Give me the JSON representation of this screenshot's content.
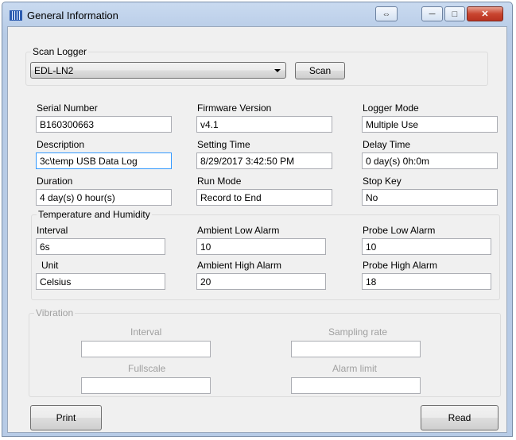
{
  "window": {
    "title": "General Information",
    "icons": {
      "app": "logger-icon",
      "switch": "switch-arrows-icon",
      "minimize": "minimize-icon",
      "maximize": "maximize-icon",
      "close": "close-icon"
    }
  },
  "scan_logger": {
    "legend": "Scan Logger",
    "selected": "EDL-LN2",
    "scan_label": "Scan"
  },
  "info": {
    "serial_number": {
      "label": "Serial Number",
      "value": "B160300663"
    },
    "firmware_version": {
      "label": "Firmware Version",
      "value": "v4.1"
    },
    "logger_mode": {
      "label": "Logger Mode",
      "value": "Multiple Use"
    },
    "description": {
      "label": "Description",
      "value": "3c\\temp USB Data Log"
    },
    "setting_time": {
      "label": "Setting Time",
      "value": "8/29/2017 3:42:50 PM"
    },
    "delay_time": {
      "label": "Delay Time",
      "value": "0 day(s) 0h:0m"
    },
    "duration": {
      "label": "Duration",
      "value": "4 day(s) 0 hour(s)"
    },
    "run_mode": {
      "label": "Run Mode",
      "value": "Record to End"
    },
    "stop_key": {
      "label": "Stop Key",
      "value": "No"
    }
  },
  "temp_humidity": {
    "legend": "Temperature and Humidity",
    "interval": {
      "label": "Interval",
      "value": "6s"
    },
    "ambient_low_alarm": {
      "label": "Ambient Low Alarm",
      "value": "10"
    },
    "probe_low_alarm": {
      "label": "Probe Low Alarm",
      "value": "10"
    },
    "unit": {
      "label": "Unit",
      "value": "Celsius"
    },
    "ambient_high_alarm": {
      "label": "Ambient High Alarm",
      "value": "20"
    },
    "probe_high_alarm": {
      "label": "Probe High Alarm",
      "value": "18"
    }
  },
  "vibration": {
    "legend": "Vibration",
    "interval": {
      "label": "Interval",
      "value": ""
    },
    "sampling_rate": {
      "label": "Sampling rate",
      "value": ""
    },
    "fullscale": {
      "label": "Fullscale",
      "value": ""
    },
    "alarm_limit": {
      "label": "Alarm limit",
      "value": ""
    }
  },
  "buttons": {
    "print": "Print",
    "read": "Read"
  }
}
